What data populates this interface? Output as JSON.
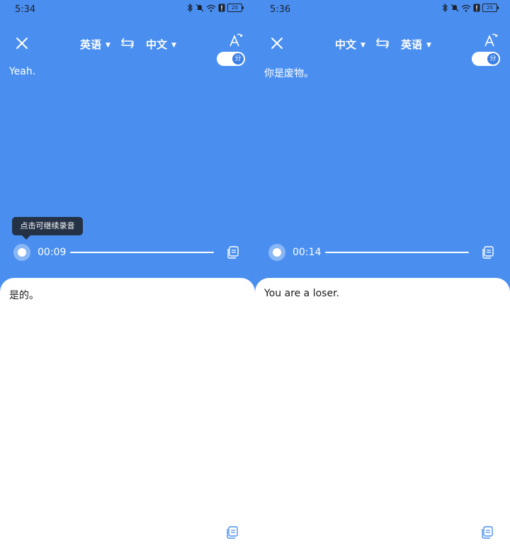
{
  "screens": [
    {
      "status_time": "5:34",
      "battery": "25",
      "source_lang": "英语",
      "target_lang": "中文",
      "toggle_label": "分",
      "source_text": "Yeah.",
      "tooltip": "点击可继续录音",
      "timer": "00:09",
      "translated_text": "是的。"
    },
    {
      "status_time": "5:36",
      "battery": "25",
      "source_lang": "中文",
      "target_lang": "英语",
      "toggle_label": "分",
      "source_text": "你是废物。",
      "timer": "00:14",
      "translated_text": "You are a loser."
    }
  ],
  "icons": {
    "close": "close-icon",
    "swap": "swap-languages-icon",
    "font": "font-size-icon",
    "copy": "copy-icon",
    "bluetooth": "bluetooth-icon",
    "mute": "bell-off-icon",
    "wifi": "wifi-icon",
    "alert": "alert-icon"
  },
  "colors": {
    "header_blue": "#4a8ff0",
    "tooltip_bg": "#253246",
    "toggle_knob": "#3a7fe6"
  }
}
